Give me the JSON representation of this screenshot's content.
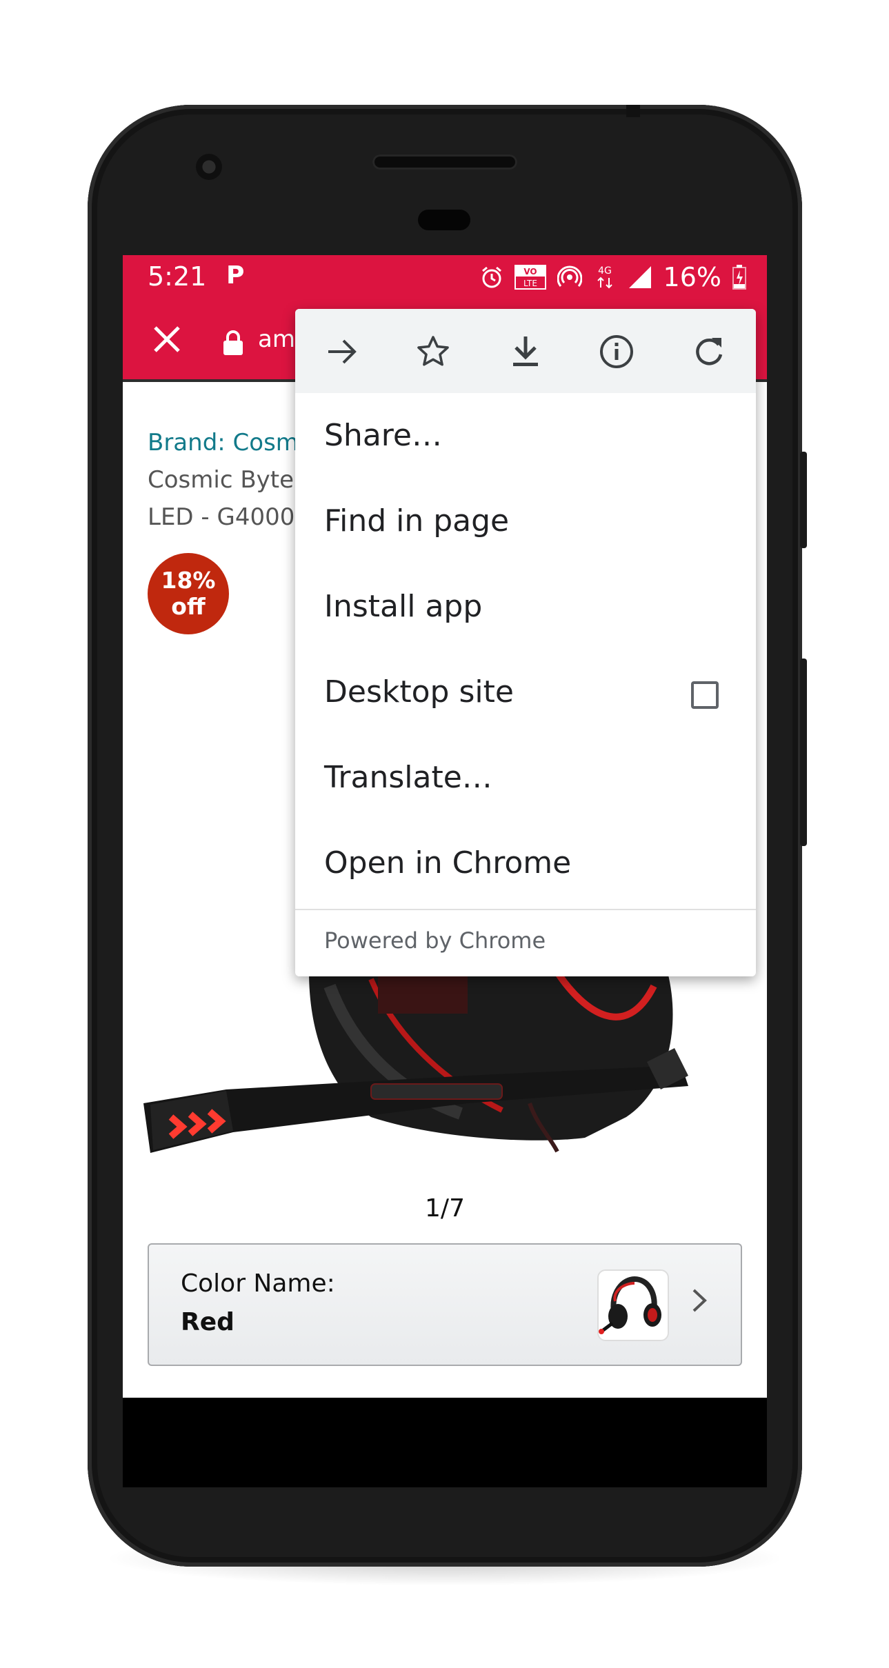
{
  "status_bar": {
    "time": "5:21",
    "notification_icon": "P",
    "network": "4G",
    "battery": "16%"
  },
  "toolbar": {
    "url": "am"
  },
  "product": {
    "brand": "Brand: Cosm",
    "title_line1": "Cosmic Byte",
    "title_line2": "LED - G4000",
    "badge_line1": "18%",
    "badge_line2": "off",
    "image_counter": "1/7",
    "color_label": "Color Name:",
    "color_value": "Red"
  },
  "menu": {
    "items": [
      {
        "label": "Share…"
      },
      {
        "label": "Find in page"
      },
      {
        "label": "Install app"
      },
      {
        "label": "Desktop site"
      },
      {
        "label": "Translate…"
      },
      {
        "label": "Open in Chrome"
      }
    ],
    "desktop_site_checked": false,
    "footer": "Powered by Chrome"
  },
  "colors": {
    "toolbar": "#dc1440",
    "badge": "#c0280e",
    "brand_link": "#127a8a"
  }
}
